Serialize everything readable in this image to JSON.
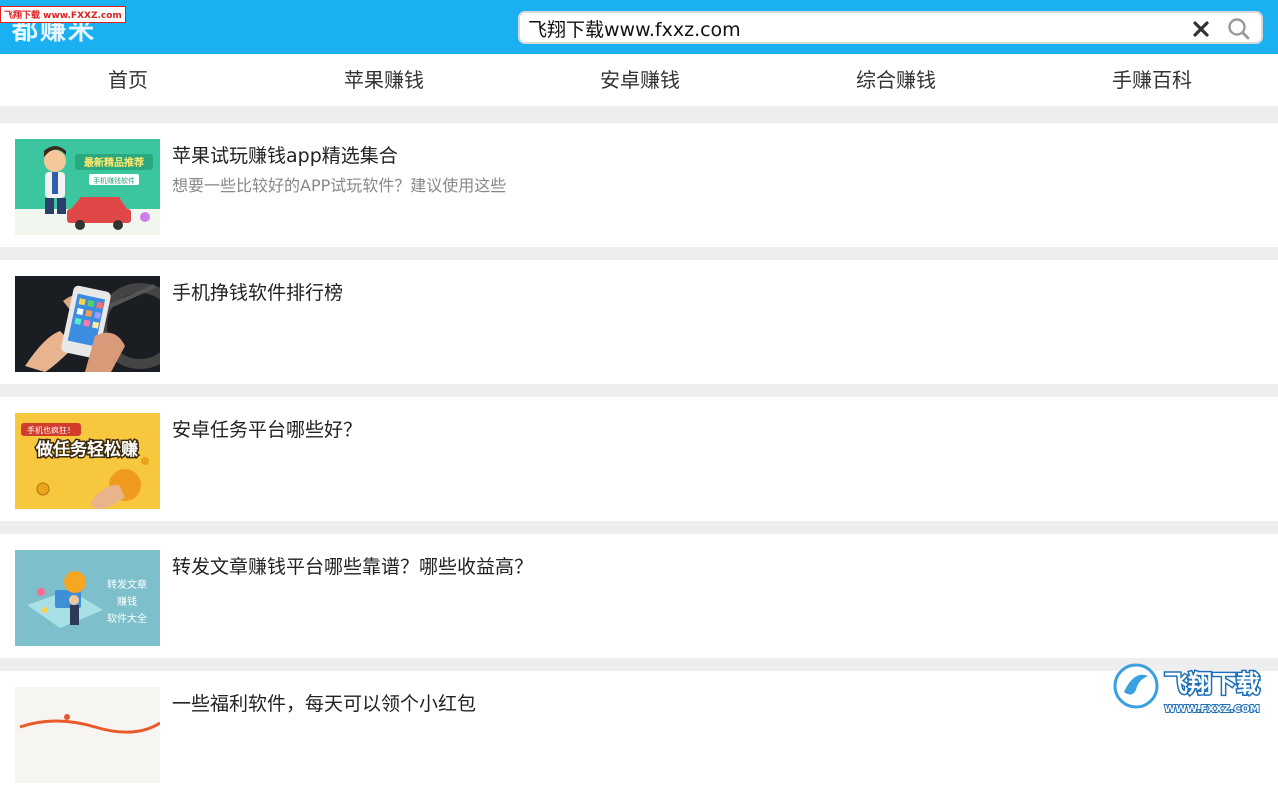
{
  "header": {
    "logo": "都赚米",
    "watermark": "飞翔下载 www.FXXZ.com",
    "search_value": "飞翔下载www.fxxz.com"
  },
  "nav": {
    "items": [
      "首页",
      "苹果赚钱",
      "安卓赚钱",
      "综合赚钱",
      "手赚百科"
    ]
  },
  "articles": [
    {
      "title": "苹果试玩赚钱app精选集合",
      "desc": "想要一些比较好的APP试玩软件？建议使用这些"
    },
    {
      "title": "手机挣钱软件排行榜",
      "desc": ""
    },
    {
      "title": "安卓任务平台哪些好？",
      "desc": ""
    },
    {
      "title": "转发文章赚钱平台哪些靠谱？哪些收益高？",
      "desc": ""
    },
    {
      "title": "一些福利软件，每天可以领个小红包",
      "desc": ""
    }
  ],
  "thumbs": {
    "t1_banner": "最新精品推荐",
    "t1_sub": "手机赚钱软件",
    "t3_tag": "手机也疯狂！",
    "t3_main": "做任务轻松赚",
    "t4_line1": "转发文章",
    "t4_line2": "赚钱",
    "t4_line3": "软件大全"
  },
  "watermark_br": {
    "brand": "飞翔下载",
    "url": "WWW.FXXZ.COM"
  },
  "colors": {
    "header": "#1ab0f2",
    "background": "#eeeeee",
    "card": "#ffffff"
  }
}
